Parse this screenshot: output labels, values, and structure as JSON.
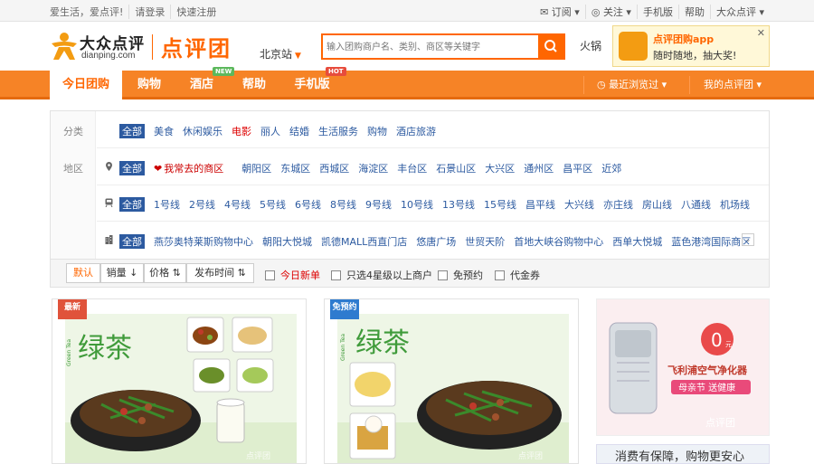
{
  "topbar": {
    "slogan": "爱生活，爱点评!",
    "login": "请登录",
    "register": "快速注册",
    "subscribe": "订阅",
    "follow": "关注",
    "mobile": "手机版",
    "help": "帮助",
    "site": "大众点评"
  },
  "header": {
    "logo_cn": "大众点评",
    "logo_en": "dianping.com",
    "brand": "点评团",
    "city": "北京站",
    "search_placeholder": "输入团购商户名、类别、商区等关键字",
    "hot_word": "火锅",
    "promo_title": "点评团购app",
    "promo_sub": "随时随地，抽大奖!"
  },
  "nav": {
    "items": [
      "今日团购",
      "购物",
      "酒店",
      "帮助",
      "手机版"
    ],
    "badge_new": "NEW",
    "badge_hot": "HOT",
    "recent": "最近浏览过",
    "my": "我的点评团"
  },
  "filters": {
    "category_label": "分类",
    "region_label": "地区",
    "all": "全部",
    "categories": [
      "美食",
      "休闲娱乐",
      "电影",
      "丽人",
      "结婚",
      "生活服务",
      "购物",
      "酒店旅游"
    ],
    "fav_region": "我常去的商区",
    "regions": [
      "朝阳区",
      "东城区",
      "西城区",
      "海淀区",
      "丰台区",
      "石景山区",
      "大兴区",
      "通州区",
      "昌平区",
      "近郊"
    ],
    "subway": [
      "1号线",
      "2号线",
      "4号线",
      "5号线",
      "6号线",
      "8号线",
      "9号线",
      "10号线",
      "13号线",
      "15号线",
      "昌平线",
      "大兴线",
      "亦庄线",
      "房山线",
      "八通线",
      "机场线"
    ],
    "malls": [
      "燕莎奥特莱斯购物中心",
      "朝阳大悦城",
      "凯德MALL西直门店",
      "悠唐广场",
      "世贸天阶",
      "首地大峡谷购物中心",
      "西单大悦城",
      "蓝色港湾国际商区"
    ]
  },
  "sort": {
    "default": "默认",
    "sales": "销量",
    "price": "价格",
    "time": "发布时间",
    "today_new": "今日新单",
    "four_star": "只选4星级以上商户",
    "no_booking": "免预约",
    "voucher": "代金券"
  },
  "cards": [
    {
      "tag": "最新",
      "title": "绿茶",
      "pinyin": "Green Tea",
      "watermark": "点评团"
    },
    {
      "tag": "免预约",
      "title": "绿茶",
      "pinyin": "Green Tea",
      "watermark": "点评团"
    }
  ],
  "ad": {
    "price": "0",
    "unit": "元",
    "product": "飞利浦空气净化器",
    "promo": "母亲节 送健康",
    "watermark": "点评团",
    "bottom": "消费有保障，购物更安心"
  },
  "colors": {
    "accent": "#ff6600",
    "nav_bg": "#f68326",
    "link": "#2c5aa0"
  }
}
